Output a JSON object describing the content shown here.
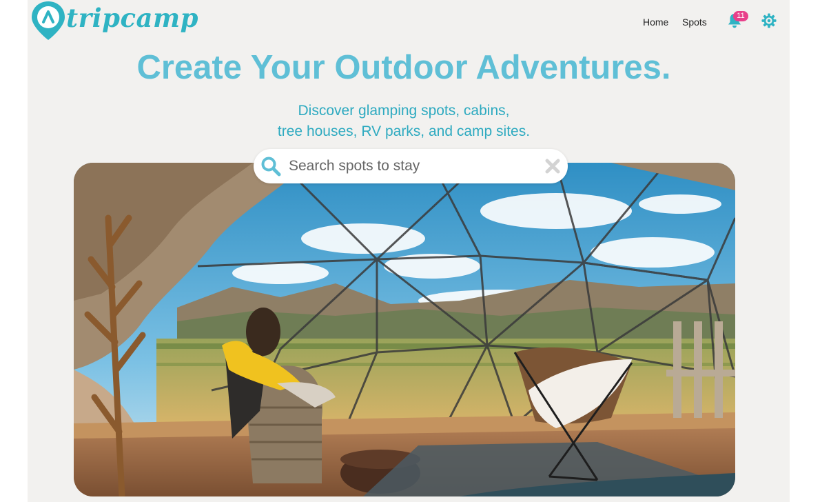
{
  "brand": {
    "name": "tripcamp",
    "accent": "#2fb3c3"
  },
  "nav": {
    "home": "Home",
    "spots": "Spots"
  },
  "notifications": {
    "count": "11",
    "icon": "bell-icon"
  },
  "settings": {
    "icon": "gear-icon"
  },
  "hero": {
    "title": "Create Your Outdoor Adventures.",
    "subtitle_line1": "Discover glamping spots, cabins,",
    "subtitle_line2": "tree houses, RV parks, and camp sites.",
    "title_color": "#5fbfd6"
  },
  "search": {
    "placeholder": "Search spots to stay",
    "value": ""
  },
  "colors": {
    "page_bg": "#f2f1ef",
    "badge": "#e8408a"
  }
}
